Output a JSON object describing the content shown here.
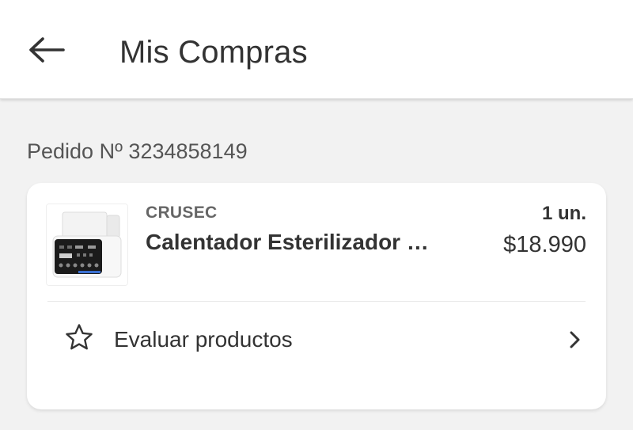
{
  "header": {
    "title": "Mis Compras",
    "back_icon": "arrow-left-icon"
  },
  "order": {
    "number_label": "Pedido Nº 3234858149",
    "product": {
      "brand": "CRUSEC",
      "name": "Calentador Esterilizador …",
      "quantity": "1 un.",
      "price": "$18.990",
      "image_icon": "bottle-warmer-product-image"
    },
    "review": {
      "label": "Evaluar productos",
      "icon": "star-outline-icon",
      "chevron": "chevron-right-icon"
    }
  },
  "colors": {
    "background": "#f2f2f2",
    "surface": "#ffffff",
    "text": "#333333"
  }
}
